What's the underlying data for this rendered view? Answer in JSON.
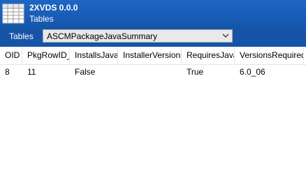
{
  "app": {
    "name": "2XVDS 0.0.0",
    "subtitle": "Tables",
    "icon": "table-grid-icon"
  },
  "toolbar": {
    "tables_label": "Tables",
    "selected_table": "ASCMPackageJavaSummary"
  },
  "grid": {
    "columns": [
      "OID",
      "PkgRowID_",
      "InstallsJava",
      "InstallerVersions",
      "RequiresJava",
      "VersionsRequired"
    ],
    "rows": [
      [
        "8",
        "11",
        "False",
        "",
        "True",
        "6.0_06"
      ]
    ]
  },
  "colors": {
    "titlebar": "#1e66c2",
    "toolbar": "#1654a8"
  }
}
